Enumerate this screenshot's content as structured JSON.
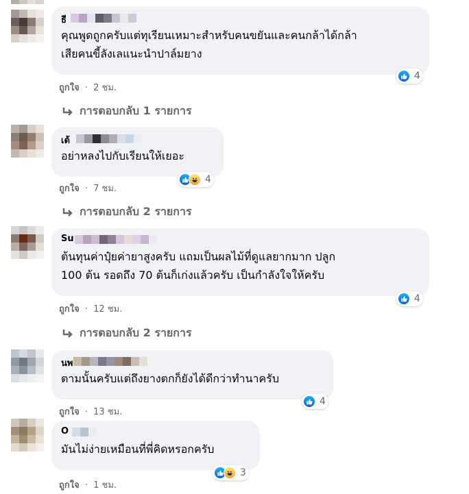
{
  "labels": {
    "like": "ถูกใจ",
    "separator": "·"
  },
  "comments": [
    {
      "name_initial": "ธี",
      "lines": [
        "คุณพูดถูกครับแต่ทุเรียนเหมาะสำหรับคนขยันและคนกล้าได้กล้า",
        "เสียคนขี้ลังเลแนะนำปาล์มยาง"
      ],
      "time": "2 ชม.",
      "reactions": [
        "like"
      ],
      "reaction_count": "4",
      "replies_label": "การตอบกลับ 1 รายการ"
    },
    {
      "name_initial": "เต้",
      "lines": [
        "อย่าหลงไปกับเรียนให้เยอะ"
      ],
      "time": "7 ชม.",
      "reactions": [
        "like",
        "haha"
      ],
      "reaction_count": "4",
      "replies_label": "การตอบกลับ 2 รายการ"
    },
    {
      "name_initial": "Su",
      "lines": [
        "ต้นทุนค่าปุ๋ยค่ายาสูงครับ แถมเป็นผลไม้ที่ดูแลยากมาก ปลูก",
        "100 ต้น รอดถึง 70 ต้นก็เก่งแล้วครับ เป็นกำลังใจให้ครับ"
      ],
      "time": "12 ชม.",
      "reactions": [
        "like"
      ],
      "reaction_count": "4",
      "replies_label": "การตอบกลับ 2 รายการ"
    },
    {
      "name_initial": "นพ",
      "lines": [
        "ตามนั้นครับแต่ถึงยางตกก็ยังได้ดีกว่าทำนาครับ"
      ],
      "time": "13 ชม.",
      "reactions": [
        "like"
      ],
      "reaction_count": "4",
      "replies_label": ""
    },
    {
      "name_initial": "O",
      "lines": [
        "มันไม่ง่ายเหมือนที่พี่คิดหรอกครับ"
      ],
      "time": "1 ชม.",
      "reactions": [
        "like",
        "haha"
      ],
      "reaction_count": "3",
      "replies_label": ""
    }
  ]
}
